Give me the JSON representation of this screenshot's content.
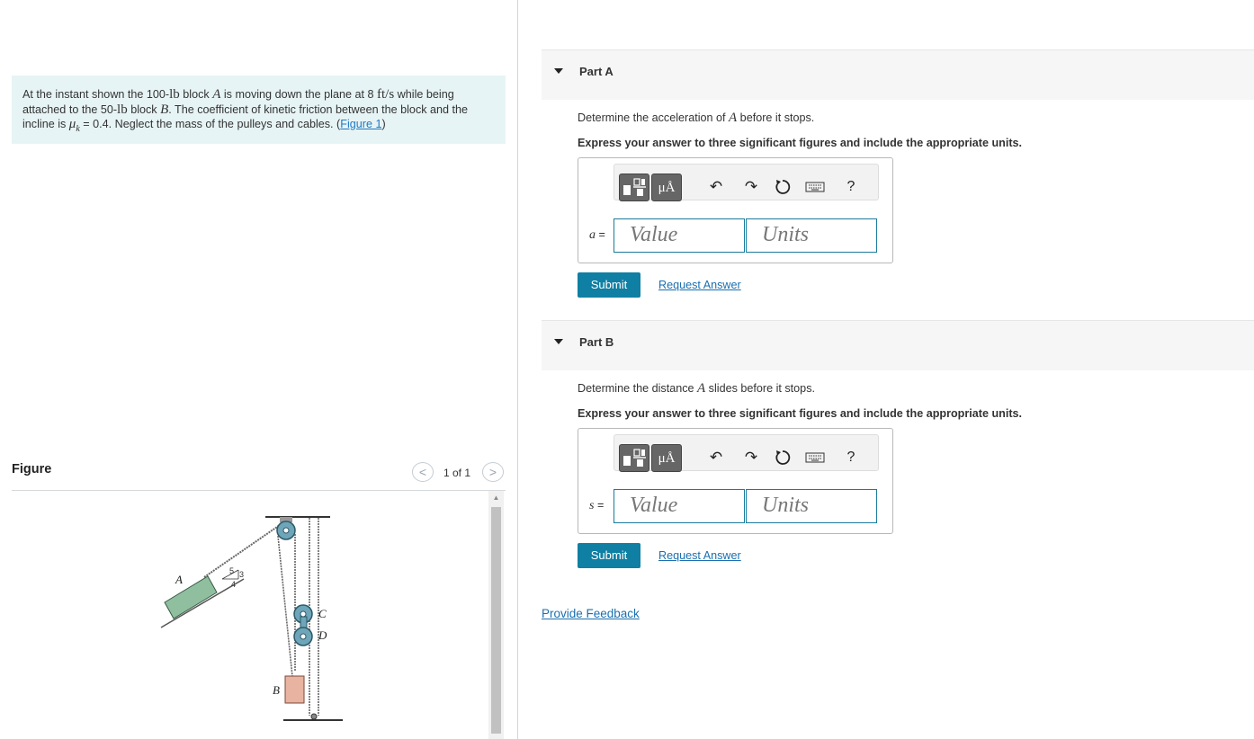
{
  "problem": {
    "text_1": "At the instant shown the 100-",
    "unit_lb": "lb",
    "text_2": " block ",
    "var_A": "A",
    "text_3": " is moving down the plane at 8 ",
    "unit_ft": "ft",
    "unit_s": "/s",
    "text_4": " while being attached to the 50-",
    "text_5": " block ",
    "var_B": "B",
    "text_6": ". The coefficient of kinetic friction between the block and the incline is ",
    "mu_symbol": "μ",
    "mu_sub": "k",
    "text_7": " = 0.4. Neglect the mass of the pulleys and cables. (",
    "figure_link": "Figure 1",
    "text_8": ")"
  },
  "figure": {
    "title": "Figure",
    "counter": "1 of 1",
    "prev_icon": "<",
    "next_icon": ">",
    "labels": {
      "A": "A",
      "B": "B",
      "C": "C",
      "D": "D",
      "slope_5": "5",
      "slope_3": "3",
      "slope_4": "4"
    },
    "colors": {
      "block_A": "#8fbf9f",
      "block_B": "#e8b3a0",
      "pulley": "#6fa5b8"
    }
  },
  "parts": [
    {
      "title": "Part A",
      "question_pre": "Determine the acceleration of ",
      "question_var": "A",
      "question_post": " before it stops.",
      "instruction": "Express your answer to three significant figures and include the appropriate units.",
      "var_label": "a",
      "var_eq": " =",
      "value_placeholder": "Value",
      "units_placeholder": "Units",
      "submit": "Submit",
      "request": "Request Answer"
    },
    {
      "title": "Part B",
      "question_pre": "Determine the distance ",
      "question_var": "A",
      "question_post": " slides before it stops.",
      "instruction": "Express your answer to three significant figures and include the appropriate units.",
      "var_label": "s",
      "var_eq": " =",
      "value_placeholder": "Value",
      "units_placeholder": "Units",
      "submit": "Submit",
      "request": "Request Answer"
    }
  ],
  "toolbar": {
    "template_icon": "template-icon",
    "mu_label": "μÅ",
    "undo_icon": "undo-icon",
    "redo_icon": "redo-icon",
    "reset_icon": "reset-icon",
    "keyboard_icon": "keyboard-icon",
    "help_label": "?"
  },
  "feedback": "Provide Feedback",
  "colors": {
    "accent": "#0f7fa3",
    "link": "#1a6fb0",
    "problem_bg": "#e7f4f5"
  }
}
